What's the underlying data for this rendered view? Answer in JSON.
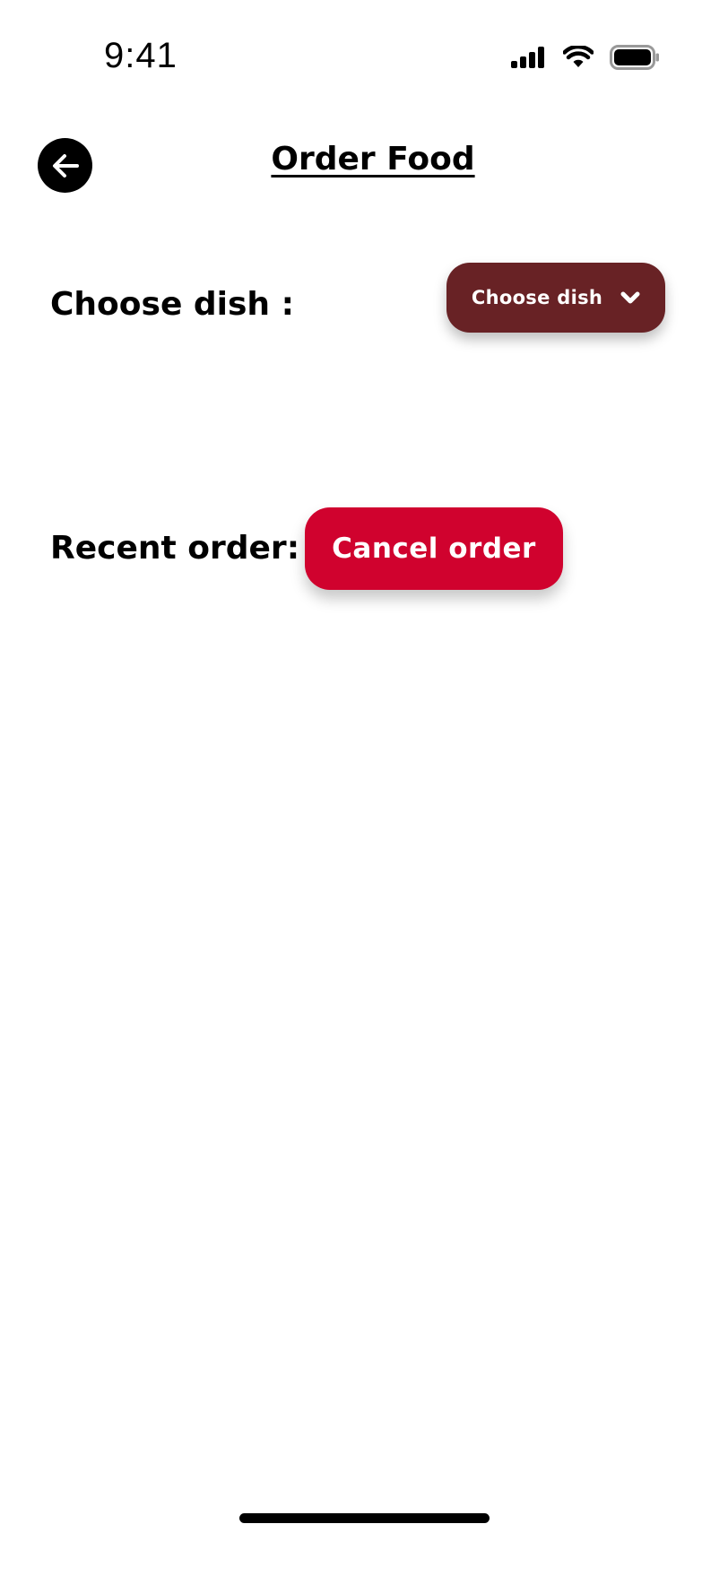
{
  "status_bar": {
    "time": "9:41",
    "icons": [
      "signal-icon",
      "wifi-icon",
      "battery-icon"
    ]
  },
  "header": {
    "title": "Order Food",
    "back_icon": "arrow-left-icon"
  },
  "choose_dish": {
    "label": "Choose dish :",
    "dropdown_label": "Choose dish",
    "dropdown_icon": "chevron-down-icon"
  },
  "recent_order": {
    "label": "Recent order:",
    "cancel_label": "Cancel order"
  },
  "colors": {
    "dropdown_bg": "#682225",
    "cancel_bg": "#d0022e",
    "text": "#000000",
    "background": "#ffffff"
  }
}
